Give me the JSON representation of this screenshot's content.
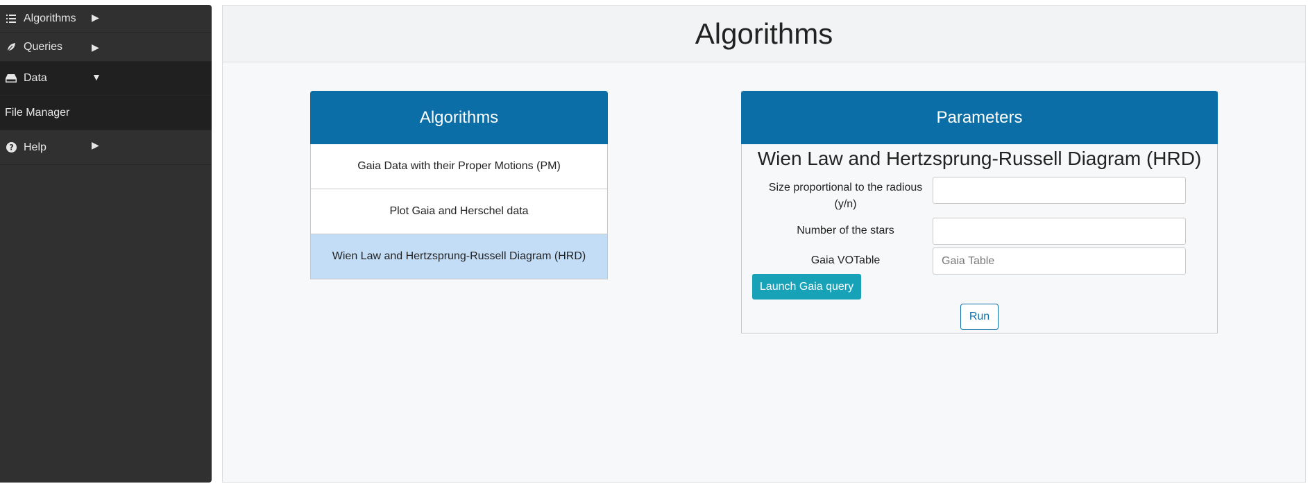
{
  "sidebar": {
    "items": [
      {
        "label": "Algorithms",
        "icon": "list-icon",
        "arrow": "▶"
      },
      {
        "label": "Queries",
        "icon": "leaf-icon",
        "arrow": "▶"
      },
      {
        "label": "Data",
        "icon": "hdd-icon",
        "arrow": "▼"
      },
      {
        "label": "File Manager"
      },
      {
        "label": "Help",
        "icon": "question-circle-icon",
        "arrow": "▶"
      }
    ]
  },
  "main": {
    "title": "Algorithms",
    "algorithms_panel": {
      "title": "Algorithms",
      "items": [
        "Gaia Data with their Proper Motions (PM)",
        "Plot Gaia and Herschel data",
        "Wien Law and Hertzsprung-Russell Diagram (HRD)"
      ],
      "selected_index": 2
    },
    "parameters_panel": {
      "title": "Parameters",
      "subtitle": "Wien Law and Hertzsprung-Russell Diagram (HRD)",
      "fields": [
        {
          "label": "Size proportional to the radious (y/n)",
          "value": "",
          "placeholder": ""
        },
        {
          "label": "Number of the stars",
          "value": "",
          "placeholder": ""
        },
        {
          "label": "Gaia VOTable",
          "value": "",
          "placeholder": "Gaia Table"
        }
      ],
      "launch_button": "Launch Gaia query",
      "run_button": "Run"
    }
  },
  "colors": {
    "sidebar_bg": "#303030",
    "card_header": "#0b6ea6",
    "selected_item": "#c3ddf7",
    "launch_button": "#17a2b8"
  }
}
